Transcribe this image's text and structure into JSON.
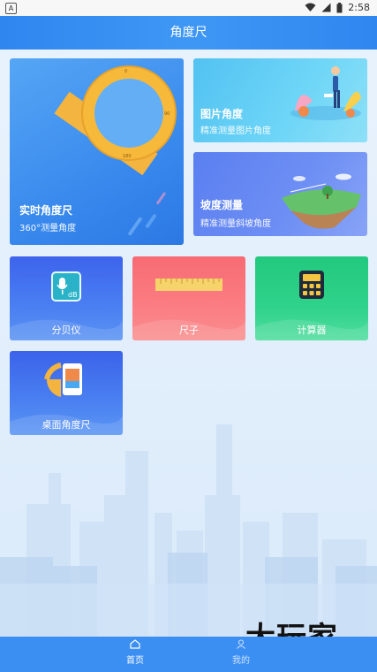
{
  "status_bar": {
    "time": "2:58",
    "app_badge": "A"
  },
  "header": {
    "title": "角度尺"
  },
  "cards": {
    "realtime": {
      "title": "实时角度尺",
      "subtitle": "360°测量角度"
    },
    "image": {
      "title": "图片角度",
      "subtitle": "精准测量图片角度"
    },
    "slope": {
      "title": "坡度测量",
      "subtitle": "精准测量斜坡角度"
    },
    "decibel": {
      "title": "分贝仪",
      "icon": "decibel-microphone-icon"
    },
    "ruler": {
      "title": "尺子",
      "icon": "ruler-icon"
    },
    "calculator": {
      "title": "计算器",
      "icon": "calculator-icon"
    },
    "desktop": {
      "title": "桌面角度尺",
      "icon": "desktop-protractor-icon"
    }
  },
  "tabs": [
    {
      "label": "首页",
      "icon": "home-icon",
      "active": true
    },
    {
      "label": "我的",
      "icon": "person-icon",
      "active": false
    }
  ],
  "watermark": "大玩家",
  "colors": {
    "header": "#3f97f5",
    "tabbar": "#3b8ff3",
    "decibel": "#3d64ec",
    "ruler": "#f76b74",
    "calculator": "#22c97e",
    "desktop": "#3b63ea"
  }
}
